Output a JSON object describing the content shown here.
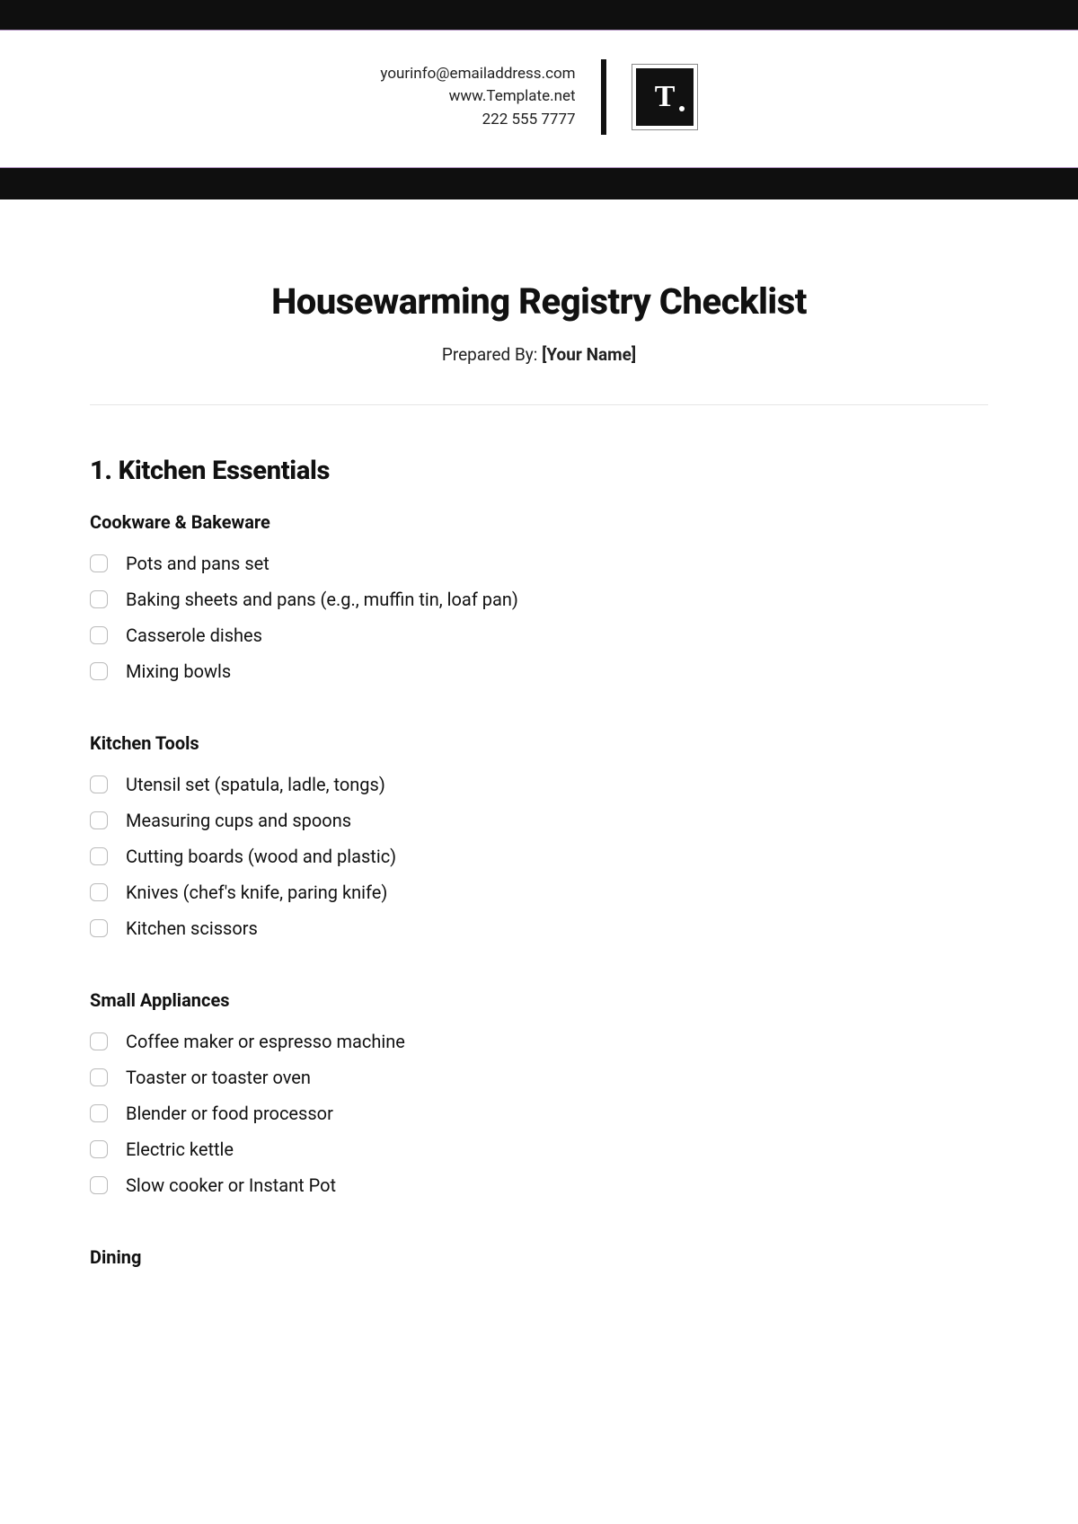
{
  "header": {
    "email": "yourinfo@emailaddress.com",
    "website": "www.Template.net",
    "phone": "222 555 7777",
    "logo_letter": "T"
  },
  "title": "Housewarming Registry Checklist",
  "prepared_label": "Prepared By: ",
  "prepared_name": "[Your Name]",
  "section": {
    "title": "1. Kitchen Essentials",
    "subsections": [
      {
        "title": "Cookware & Bakeware",
        "items": [
          "Pots and pans set",
          "Baking sheets and pans (e.g., muffin tin, loaf pan)",
          "Casserole dishes",
          "Mixing bowls"
        ]
      },
      {
        "title": "Kitchen Tools",
        "items": [
          "Utensil set (spatula, ladle, tongs)",
          "Measuring cups and spoons",
          "Cutting boards (wood and plastic)",
          "Knives (chef's knife, paring knife)",
          "Kitchen scissors"
        ]
      },
      {
        "title": "Small Appliances",
        "items": [
          "Coffee maker or espresso machine",
          "Toaster or toaster oven",
          "Blender or food processor",
          "Electric kettle",
          "Slow cooker or Instant Pot"
        ]
      },
      {
        "title": "Dining",
        "items": []
      }
    ]
  }
}
